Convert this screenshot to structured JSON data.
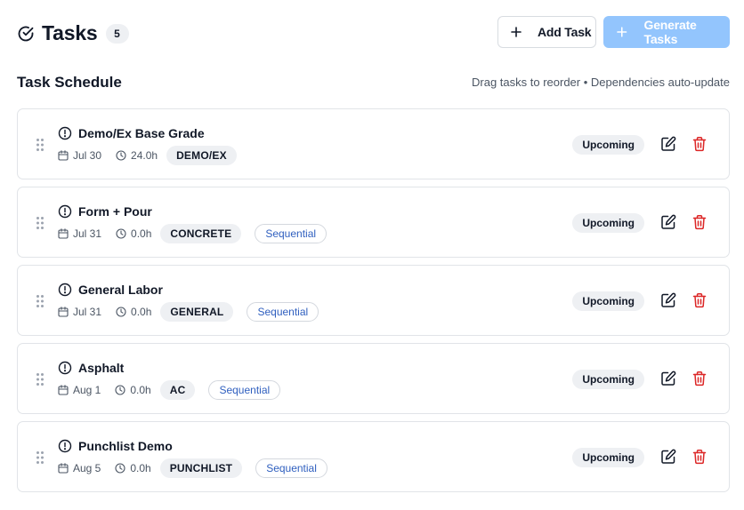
{
  "header": {
    "title": "Tasks",
    "count": "5",
    "add_label": "Add Task",
    "generate_label": "Generate Tasks"
  },
  "schedule": {
    "title": "Task Schedule",
    "hint": "Drag tasks to reorder • Dependencies auto-update"
  },
  "tasks": [
    {
      "name": "Demo/Ex Base Grade",
      "date": "Jul 30",
      "duration": "24.0h",
      "tag": "DEMO/EX",
      "dependency": "",
      "status": "Upcoming"
    },
    {
      "name": "Form + Pour",
      "date": "Jul 31",
      "duration": "0.0h",
      "tag": "CONCRETE",
      "dependency": "Sequential",
      "status": "Upcoming"
    },
    {
      "name": "General Labor",
      "date": "Jul 31",
      "duration": "0.0h",
      "tag": "GENERAL",
      "dependency": "Sequential",
      "status": "Upcoming"
    },
    {
      "name": "Asphalt",
      "date": "Aug 1",
      "duration": "0.0h",
      "tag": "AC",
      "dependency": "Sequential",
      "status": "Upcoming"
    },
    {
      "name": "Punchlist Demo",
      "date": "Aug 5",
      "duration": "0.0h",
      "tag": "PUNCHLIST",
      "dependency": "Sequential",
      "status": "Upcoming"
    }
  ],
  "icons": {
    "title": "check-circle-icon",
    "add": "plus-icon",
    "generate": "plus-icon",
    "grip": "drag-handle-icon",
    "status": "alert-circle-icon",
    "date": "calendar-icon",
    "duration": "clock-icon",
    "edit": "edit-icon",
    "delete": "trash-icon"
  },
  "colors": {
    "primary_disabled": "#93c5fd",
    "delete": "#dc2626",
    "dependency_text": "#2f5fbf"
  }
}
